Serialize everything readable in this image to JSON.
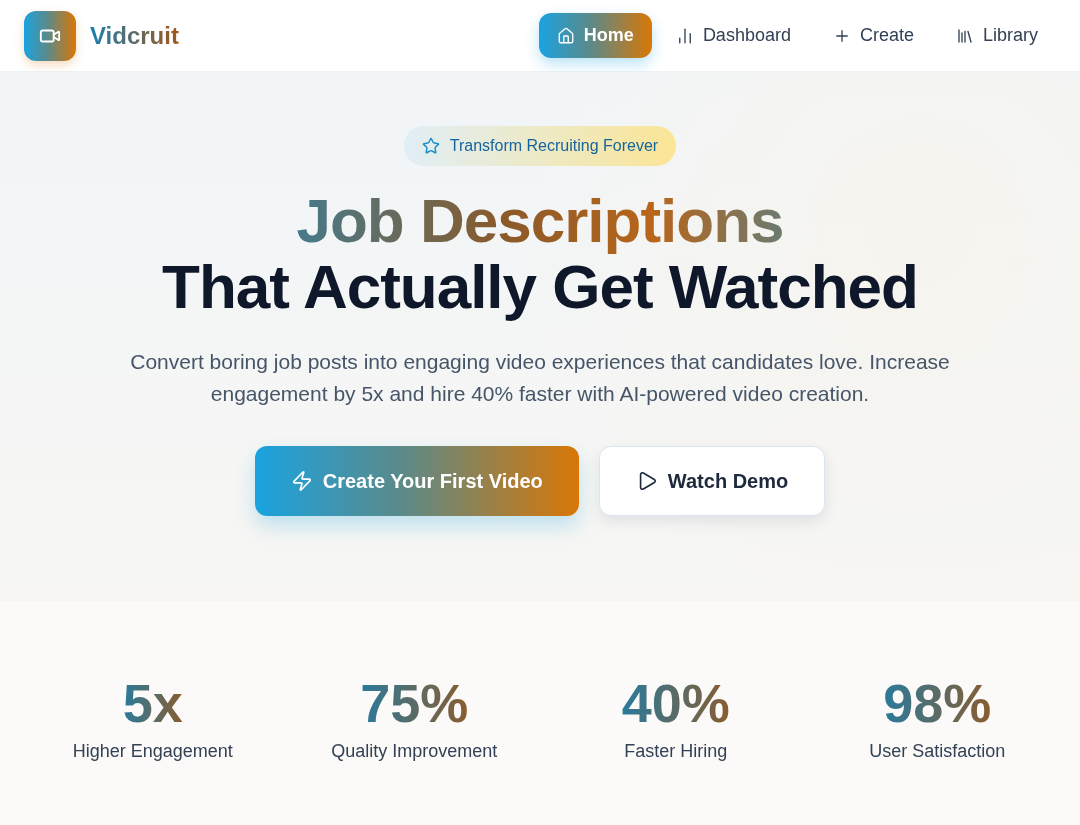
{
  "brand": {
    "name": "Vidcruit"
  },
  "nav": [
    {
      "kind": "home",
      "label": "Home",
      "selected": true
    },
    {
      "kind": "dashboard",
      "label": "Dashboard",
      "selected": false
    },
    {
      "kind": "create",
      "label": "Create",
      "selected": false
    },
    {
      "kind": "library",
      "label": "Library",
      "selected": false
    }
  ],
  "hero": {
    "badge": "Transform Recruiting Forever",
    "headline_1": "Job Descriptions",
    "headline_2": "That Actually Get Watched",
    "subtitle": "Convert boring job posts into engaging video experiences that candidates love. Increase engagement by 5x and hire 40% faster with AI-powered video creation.",
    "buttons": [
      {
        "kind": "primary",
        "label": "Create Your First Video"
      },
      {
        "kind": "secondary",
        "label": "Watch Demo"
      }
    ]
  },
  "stats": [
    {
      "value": "5x",
      "label": "Higher Engagement"
    },
    {
      "value": "75%",
      "label": "Quality Improvement"
    },
    {
      "value": "40%",
      "label": "Faster Hiring"
    },
    {
      "value": "98%",
      "label": "User Satisfaction"
    }
  ]
}
